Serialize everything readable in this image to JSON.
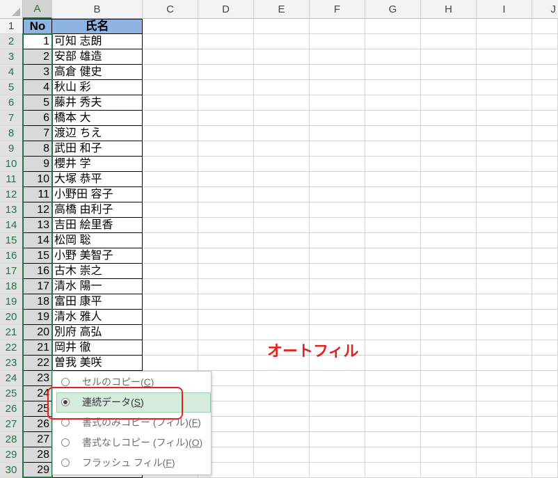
{
  "sheet": {
    "columns": [
      "A",
      "B",
      "C",
      "D",
      "E",
      "F",
      "G",
      "H",
      "I",
      "J"
    ],
    "rows": [
      "1",
      "2",
      "3",
      "4",
      "5",
      "6",
      "7",
      "8",
      "9",
      "10",
      "11",
      "12",
      "13",
      "14",
      "15",
      "16",
      "17",
      "18",
      "19",
      "20",
      "21",
      "22",
      "23",
      "24",
      "25",
      "26",
      "27",
      "28",
      "29",
      "30"
    ],
    "table_header": {
      "no": "No",
      "name": "氏名"
    },
    "records": [
      {
        "no": "1",
        "name": "可知 志朗"
      },
      {
        "no": "2",
        "name": "安部 雄造"
      },
      {
        "no": "3",
        "name": "高倉 健史"
      },
      {
        "no": "4",
        "name": "秋山 彩"
      },
      {
        "no": "5",
        "name": "藤井 秀夫"
      },
      {
        "no": "6",
        "name": "橋本 大"
      },
      {
        "no": "7",
        "name": "渡辺 ちえ"
      },
      {
        "no": "8",
        "name": "武田 和子"
      },
      {
        "no": "9",
        "name": "櫻井 学"
      },
      {
        "no": "10",
        "name": "大塚 恭平"
      },
      {
        "no": "11",
        "name": "小野田 容子"
      },
      {
        "no": "12",
        "name": "高橋 由利子"
      },
      {
        "no": "13",
        "name": "吉田 絵里香"
      },
      {
        "no": "14",
        "name": "松岡 聡"
      },
      {
        "no": "15",
        "name": "小野 美智子"
      },
      {
        "no": "16",
        "name": "古木 崇之"
      },
      {
        "no": "17",
        "name": "清水 陽一"
      },
      {
        "no": "18",
        "name": "富田 康平"
      },
      {
        "no": "19",
        "name": "清水 雅人"
      },
      {
        "no": "20",
        "name": "別府 高弘"
      },
      {
        "no": "21",
        "name": "岡井 徹"
      },
      {
        "no": "22",
        "name": "曽我 美咲"
      },
      {
        "no": "23"
      },
      {
        "no": "24"
      },
      {
        "no": "25"
      },
      {
        "no": "26"
      },
      {
        "no": "27"
      },
      {
        "no": "28"
      },
      {
        "no": "29"
      }
    ]
  },
  "autofill_menu": {
    "options": [
      {
        "label_before": "セルのコピー(",
        "accel": "C",
        "label_after": ")",
        "selected": false
      },
      {
        "label_before": "連続データ(",
        "accel": "S",
        "label_after": ")",
        "selected": true
      },
      {
        "label_before": "書式のみコピー (フィル)(",
        "accel": "F",
        "label_after": ")",
        "selected": false
      },
      {
        "label_before": "書式なしコピー (フィル)(",
        "accel": "O",
        "label_after": ")",
        "selected": false
      },
      {
        "label_before": "フラッシュ フィル(",
        "accel": "F",
        "label_after": ")",
        "selected": false
      }
    ]
  },
  "annotation": {
    "label": "オートフィル"
  },
  "icons": {
    "radio": "radio-button-icon",
    "corner": "select-all-triangle-icon"
  },
  "colors": {
    "accent": "#217346",
    "table_header_fill": "#8DB4E2",
    "annotation": "#E5211E",
    "selected_option_fill": "#D5EBDB"
  }
}
